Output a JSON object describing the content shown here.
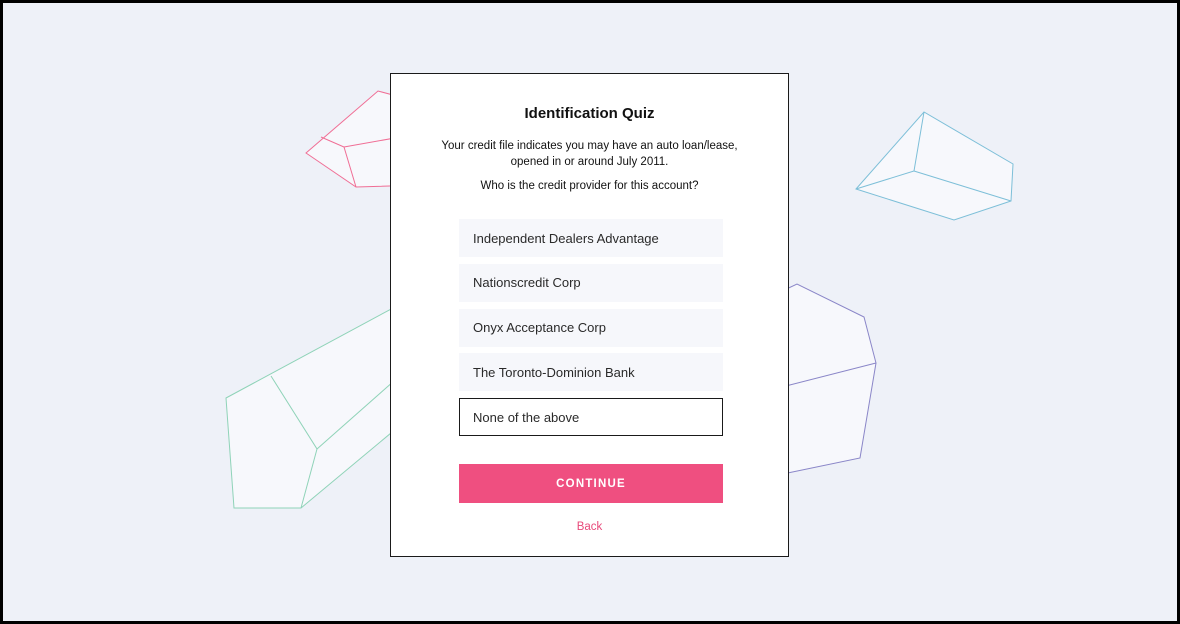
{
  "quiz": {
    "title": "Identification Quiz",
    "description": "Your credit file indicates you may have an auto loan/lease, opened in or around July 2011.",
    "question": "Who is the credit provider for this account?",
    "options": [
      "Independent Dealers Advantage",
      "Nationscredit Corp",
      "Onyx Acceptance Corp",
      "The Toronto-Dominion Bank",
      "None of the above"
    ],
    "selected_option": "None of the above",
    "continue_label": "CONTINUE",
    "back_label": "Back"
  },
  "colors": {
    "accent": "#ef4f80",
    "background": "#eef1f8",
    "shape_pink": "#f06e95",
    "shape_blue": "#7dbfd8",
    "shape_green": "#8fd3b8",
    "shape_purple": "#8a86c8"
  }
}
